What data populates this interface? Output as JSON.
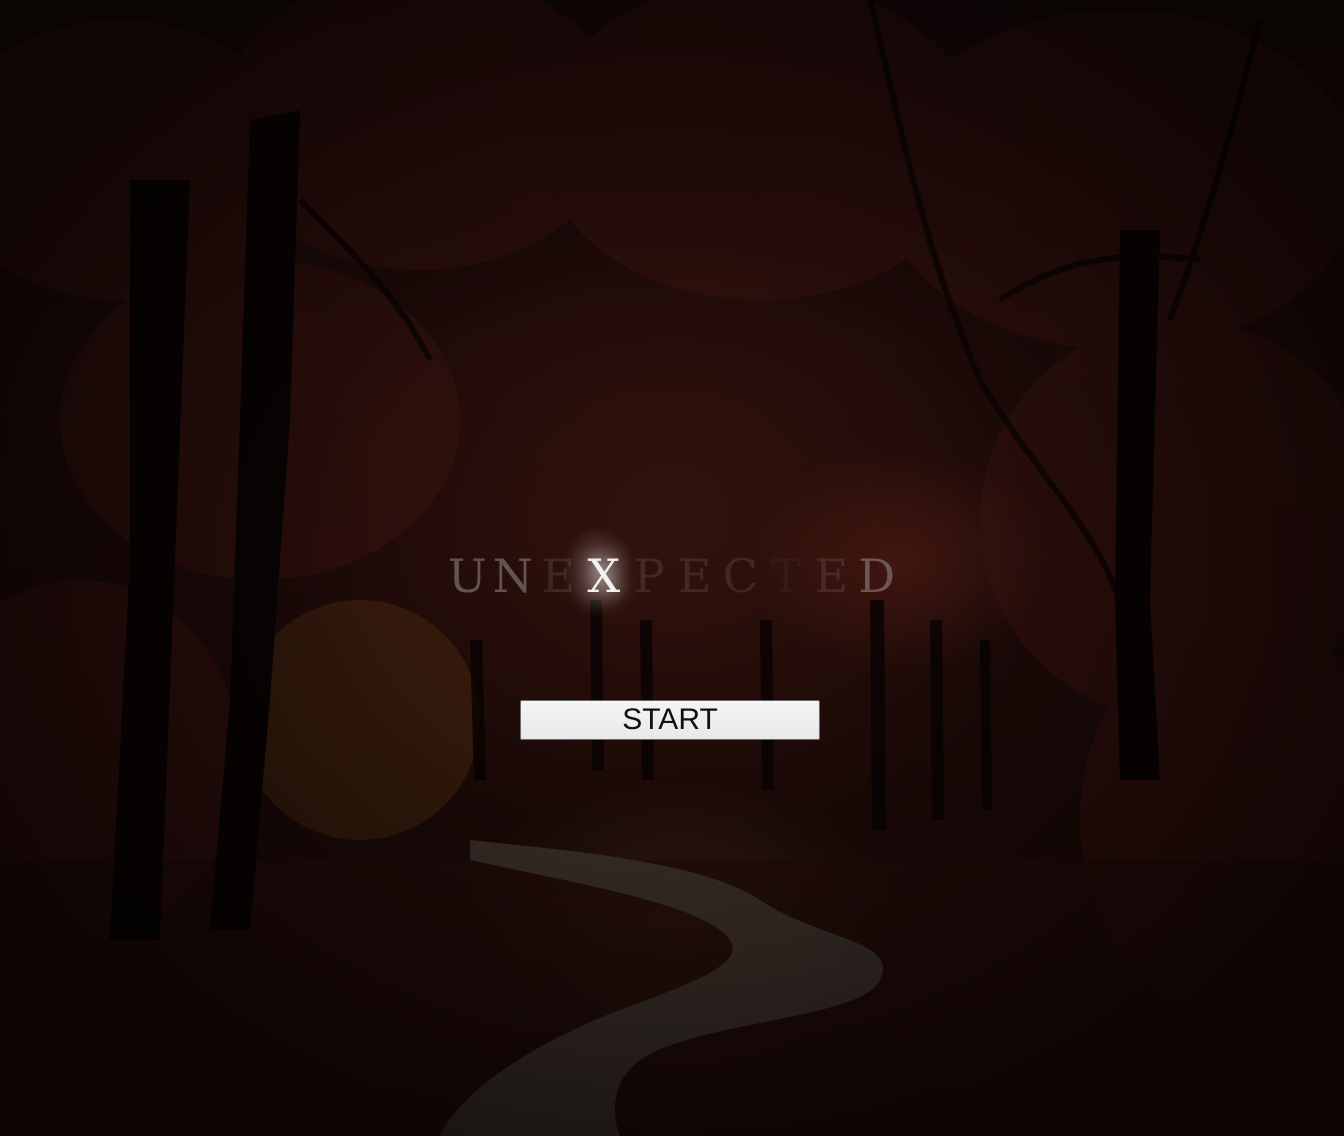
{
  "game": {
    "title_letters": [
      "U",
      "N",
      "E",
      "X",
      "P",
      "E",
      "C",
      "T",
      "E",
      "D"
    ],
    "highlighted_letter": "X",
    "start_button_label": "START"
  },
  "background": {
    "scene": "dark autumn forest with winding path",
    "colors": {
      "base": "#1a0907",
      "leaves": "#3a1410",
      "path": "#4a4038",
      "trunks": "#080302"
    }
  }
}
